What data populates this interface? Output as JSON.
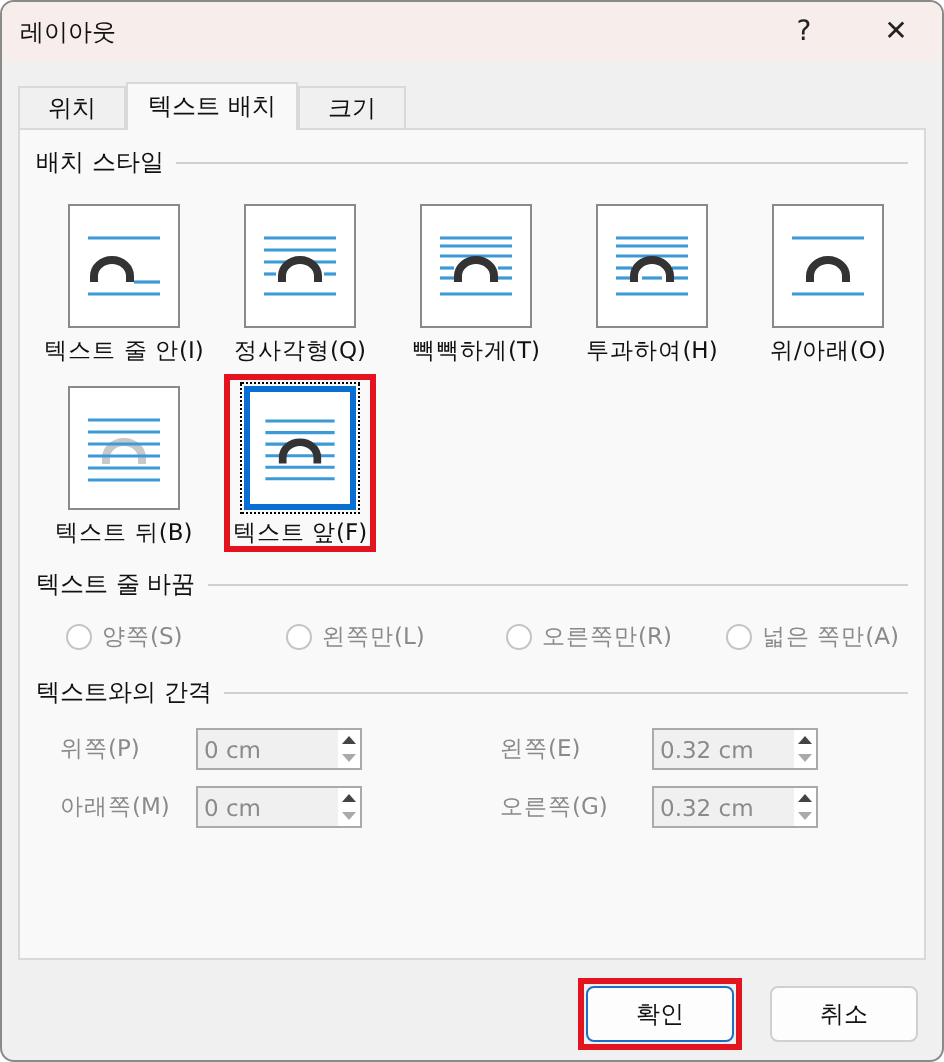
{
  "window": {
    "title": "레이아웃",
    "help": "?",
    "close": "✕"
  },
  "tabs": [
    {
      "label": "위치",
      "selected": false
    },
    {
      "label": "텍스트 배치",
      "selected": true
    },
    {
      "label": "크기",
      "selected": false
    }
  ],
  "styles": {
    "title": "배치 스타일",
    "items": [
      {
        "kind": "inline",
        "label": "텍스트 줄 안(I)",
        "selected": false,
        "highlighted": false
      },
      {
        "kind": "square",
        "label": "정사각형(Q)",
        "selected": false,
        "highlighted": false
      },
      {
        "kind": "tight",
        "label": "빽빽하게(T)",
        "selected": false,
        "highlighted": false
      },
      {
        "kind": "through",
        "label": "투과하여(H)",
        "selected": false,
        "highlighted": false
      },
      {
        "kind": "topbottom",
        "label": "위/아래(O)",
        "selected": false,
        "highlighted": false
      },
      {
        "kind": "behind",
        "label": "텍스트 뒤(B)",
        "selected": false,
        "highlighted": false
      },
      {
        "kind": "front",
        "label": "텍스트 앞(F)",
        "selected": true,
        "highlighted": true
      }
    ]
  },
  "wrap": {
    "title": "텍스트 줄 바꿈",
    "options": [
      {
        "label": "양쪽(S)",
        "selected": false,
        "disabled": true
      },
      {
        "label": "왼쪽만(L)",
        "selected": false,
        "disabled": true
      },
      {
        "label": "오른쪽만(R)",
        "selected": false,
        "disabled": true
      },
      {
        "label": "넓은 쪽만(A)",
        "selected": false,
        "disabled": true
      }
    ]
  },
  "distance": {
    "title": "텍스트와의 간격",
    "fields": [
      {
        "label": "위쪽(P)",
        "value": "0 cm",
        "disabled": true
      },
      {
        "label": "왼쪽(E)",
        "value": "0.32 cm",
        "disabled": true
      },
      {
        "label": "아래쪽(M)",
        "value": "0 cm",
        "disabled": true
      },
      {
        "label": "오른쪽(G)",
        "value": "0.32 cm",
        "disabled": true
      }
    ]
  },
  "buttons": [
    {
      "label": "확인",
      "default": true,
      "highlighted": true
    },
    {
      "label": "취소",
      "default": false,
      "highlighted": false
    }
  ]
}
